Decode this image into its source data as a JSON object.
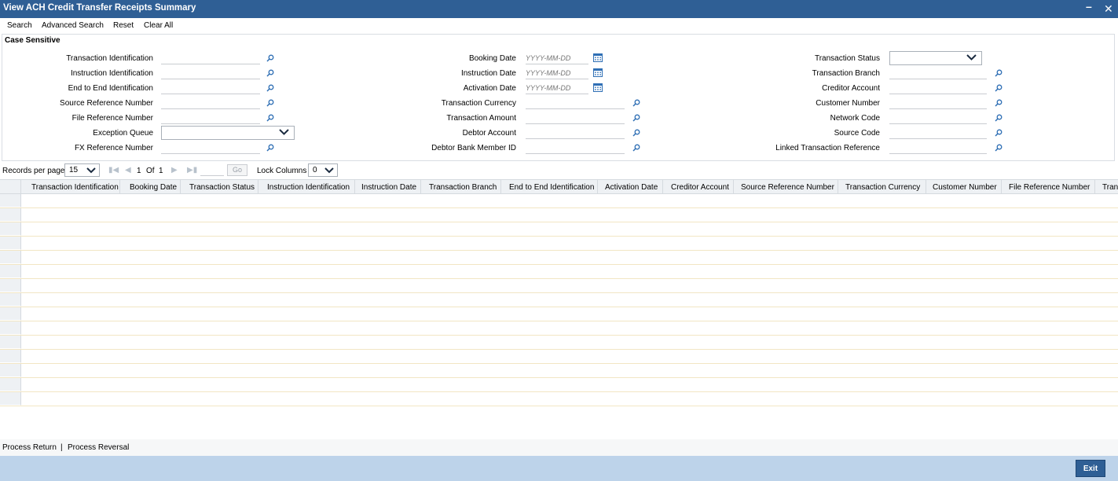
{
  "window": {
    "title": "View ACH Credit Transfer Receipts Summary",
    "minimize_glyph": "–",
    "close_glyph": "✕"
  },
  "menu": {
    "search": "Search",
    "advanced_search": "Advanced Search",
    "reset": "Reset",
    "clear_all": "Clear All"
  },
  "criteria": {
    "case_sensitive": "Case Sensitive",
    "col1": [
      {
        "label": "Transaction Identification",
        "type": "lookup"
      },
      {
        "label": "Instruction Identification",
        "type": "lookup"
      },
      {
        "label": "End to End Identification",
        "type": "lookup"
      },
      {
        "label": "Source Reference Number",
        "type": "lookup"
      },
      {
        "label": "File Reference Number",
        "type": "lookup"
      },
      {
        "label": "Exception Queue",
        "type": "select",
        "value": ""
      },
      {
        "label": "FX Reference Number",
        "type": "lookup"
      }
    ],
    "col2": [
      {
        "label": "Booking Date",
        "type": "date",
        "placeholder": "YYYY-MM-DD"
      },
      {
        "label": "Instruction Date",
        "type": "date",
        "placeholder": "YYYY-MM-DD"
      },
      {
        "label": "Activation Date",
        "type": "date",
        "placeholder": "YYYY-MM-DD"
      },
      {
        "label": "Transaction Currency",
        "type": "lookup"
      },
      {
        "label": "Transaction Amount",
        "type": "lookup"
      },
      {
        "label": "Debtor Account",
        "type": "lookup"
      },
      {
        "label": "Debtor Bank Member ID",
        "type": "lookup"
      }
    ],
    "col3": [
      {
        "label": "Transaction Status",
        "type": "select",
        "value": ""
      },
      {
        "label": "Transaction Branch",
        "type": "lookup"
      },
      {
        "label": "Creditor Account",
        "type": "lookup"
      },
      {
        "label": "Customer Number",
        "type": "lookup"
      },
      {
        "label": "Network Code",
        "type": "lookup"
      },
      {
        "label": "Source Code",
        "type": "lookup"
      },
      {
        "label": "Linked Transaction Reference",
        "type": "lookup"
      }
    ]
  },
  "pager": {
    "records_per_page_label": "Records per page",
    "records_per_page_value": "15",
    "current_page": "1",
    "of_label": "Of",
    "total_pages": "1",
    "go_label": "Go",
    "lock_columns_label": "Lock Columns",
    "lock_columns_value": "0"
  },
  "grid": {
    "columns": [
      "Transaction Identification",
      "Booking Date",
      "Transaction Status",
      "Instruction Identification",
      "Instruction Date",
      "Transaction Branch",
      "End to End Identification",
      "Activation Date",
      "Creditor Account",
      "Source Reference Number",
      "Transaction Currency",
      "Customer Number",
      "File Reference Number",
      "Tran"
    ],
    "rows": [
      "",
      "",
      "",
      "",
      "",
      "",
      "",
      "",
      "",
      "",
      "",
      "",
      "",
      "",
      ""
    ]
  },
  "actions": {
    "process_return": "Process Return",
    "separator": "|",
    "process_reversal": "Process Reversal"
  },
  "footer": {
    "exit": "Exit"
  },
  "colors": {
    "title_bar": "#2f5f95",
    "footer": "#bdd3ea",
    "icon_blue": "#2f6fb5"
  },
  "icons": {
    "lookup": "magnifier-icon",
    "date": "calendar-icon",
    "dropdown": "chevron-down-icon"
  }
}
